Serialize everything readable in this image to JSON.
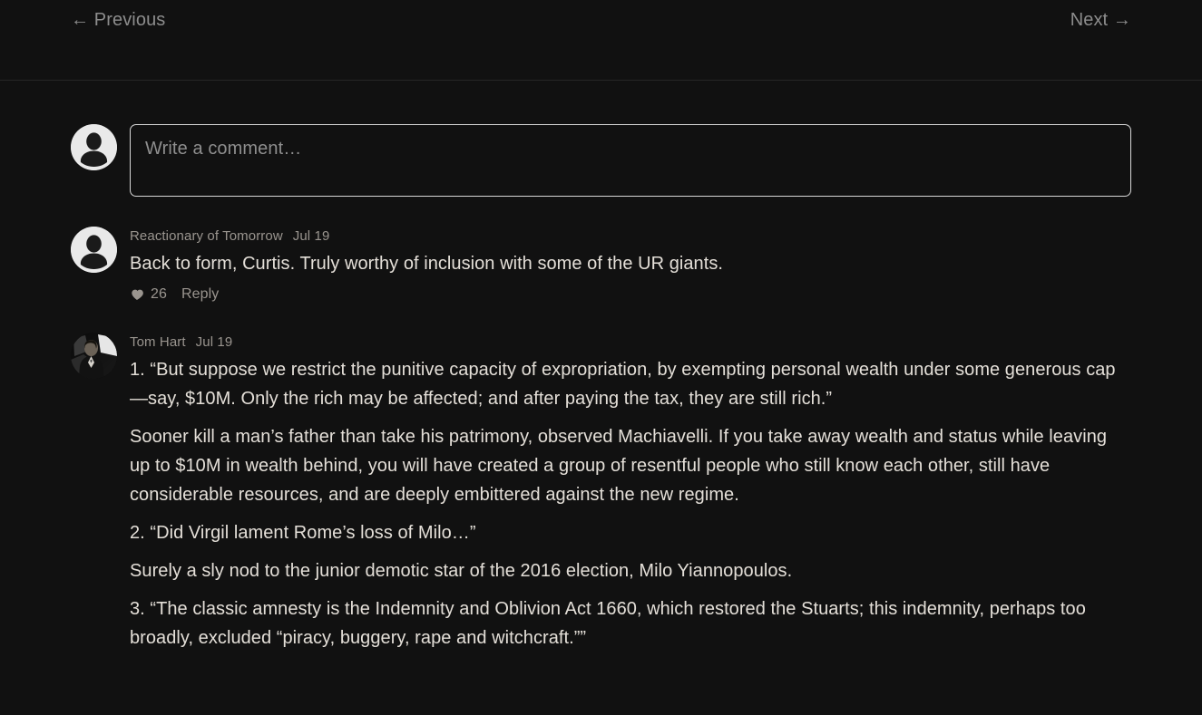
{
  "nav": {
    "previous_label": "Previous",
    "previous_arrow": "←",
    "next_label": "Next",
    "next_arrow": "→"
  },
  "composer": {
    "placeholder": "Write a comment…",
    "avatar_icon": "default-user-avatar"
  },
  "comments": [
    {
      "author": "Reactionary of Tomorrow",
      "date": "Jul 19",
      "avatar_icon": "default-user-avatar",
      "paragraphs": [
        "Back to form, Curtis. Truly worthy of inclusion with some of the UR giants."
      ],
      "like_count": "26",
      "reply_label": "Reply",
      "heart_icon": "heart-icon"
    },
    {
      "author": "Tom Hart",
      "date": "Jul 19",
      "avatar_icon": "photo-avatar",
      "paragraphs": [
        "1. “But suppose we restrict the punitive capacity of expropriation, by exempting personal wealth under some generous cap—say, $10M. Only the rich may be affected; and after paying the tax, they are still rich.”",
        "Sooner kill a man’s father than take his patrimony, observed Machiavelli. If you take away wealth and status while leaving up to $10M in wealth behind, you will have created a group of resentful people who still know each other, still have considerable resources, and are deeply embittered against the new regime.",
        "2. “Did Virgil lament Rome’s loss of Milo…”",
        "Surely a sly nod to the junior demotic star of the 2016 election, Milo Yiannopoulos.",
        "3. “The classic amnesty is the Indemnity and Oblivion Act 1660, which restored the Stuarts; this indemnity, perhaps too broadly, excluded “piracy, buggery, rape and witchcraft.””"
      ]
    }
  ],
  "colors": {
    "background": "#111111",
    "text": "#e4dfd8",
    "muted": "#9a958f",
    "border": "#d8d8d8",
    "divider": "#262626"
  }
}
